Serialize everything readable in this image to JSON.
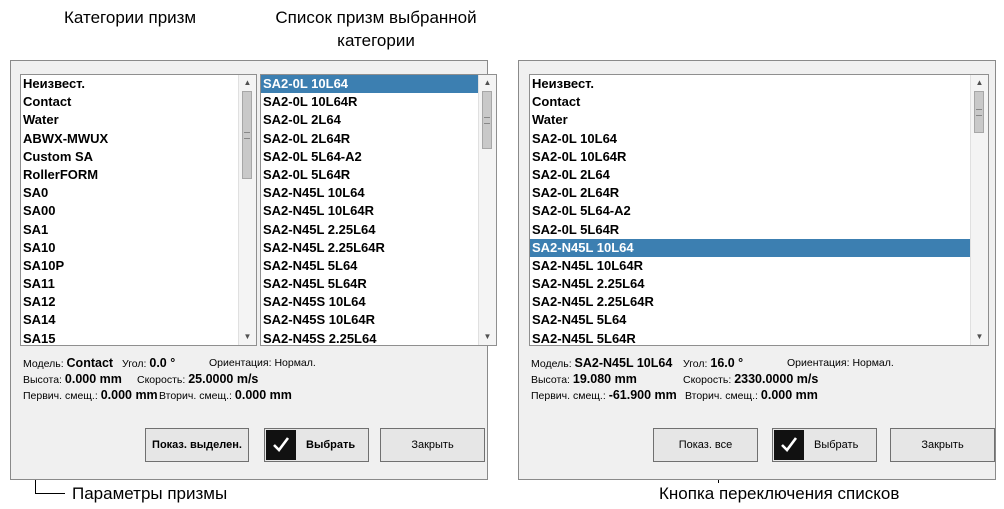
{
  "callouts": {
    "categories": "Категории призм",
    "list_line1": "Список призм выбранной",
    "list_line2": "категории",
    "params": "Параметры призмы",
    "switch_button": "Кнопка переключения списков"
  },
  "left_dialog": {
    "categories": [
      "Неизвест.",
      "Contact",
      "Water",
      "ABWX-MWUX",
      "Custom SA",
      "RollerFORM",
      "SA0",
      "SA00",
      "SA1",
      "SA10",
      "SA10P",
      "SA11",
      "SA12",
      "SA14",
      "SA15"
    ],
    "wedges": [
      "SA2-0L 10L64",
      "SA2-0L 10L64R",
      "SA2-0L 2L64",
      "SA2-0L 2L64R",
      "SA2-0L 5L64-A2",
      "SA2-0L 5L64R",
      "SA2-N45L 10L64",
      "SA2-N45L 10L64R",
      "SA2-N45L 2.25L64",
      "SA2-N45L 2.25L64R",
      "SA2-N45L 5L64",
      "SA2-N45L 5L64R",
      "SA2-N45S 10L64",
      "SA2-N45S 10L64R",
      "SA2-N45S 2.25L64"
    ],
    "selected_wedge": "SA2-0L 10L64",
    "params": {
      "model_label": "Модель:",
      "model_value": "Contact",
      "angle_label": "Угол:",
      "angle_value": "0.0 °",
      "orientation_label": "Ориентация:",
      "orientation_value": "Нормал.",
      "height_label": "Высота:",
      "height_value": "0.000 mm",
      "speed_label": "Скорость:",
      "speed_value": "25.0000 m/s",
      "primary_label": "Первич. смещ.:",
      "primary_value": "0.000 mm",
      "secondary_label": "Вторич. смещ.:",
      "secondary_value": "0.000 mm"
    },
    "buttons": {
      "toggle": "Показ. выделен.",
      "select": "Выбрать",
      "close": "Закрыть"
    }
  },
  "right_dialog": {
    "items": [
      "Неизвест.",
      "Contact",
      "Water",
      "SA2-0L 10L64",
      "SA2-0L 10L64R",
      "SA2-0L 2L64",
      "SA2-0L 2L64R",
      "SA2-0L 5L64-A2",
      "SA2-0L 5L64R",
      "SA2-N45L 10L64",
      "SA2-N45L 10L64R",
      "SA2-N45L 2.25L64",
      "SA2-N45L 2.25L64R",
      "SA2-N45L 5L64",
      "SA2-N45L 5L64R"
    ],
    "selected_item": "SA2-N45L 10L64",
    "params": {
      "model_label": "Модель:",
      "model_value": "SA2-N45L 10L64",
      "angle_label": "Угол:",
      "angle_value": "16.0 °",
      "orientation_label": "Ориентация:",
      "orientation_value": "Нормал.",
      "height_label": "Высота:",
      "height_value": "19.080 mm",
      "speed_label": "Скорость:",
      "speed_value": "2330.0000 m/s",
      "primary_label": "Первич. смещ.:",
      "primary_value": "-61.900 mm",
      "secondary_label": "Вторич. смещ.:",
      "secondary_value": "0.000 mm"
    },
    "buttons": {
      "toggle": "Показ. все",
      "select": "Выбрать",
      "close": "Закрыть"
    }
  },
  "colors": {
    "selection": "#3c7fb1",
    "panel_bg": "#f0f0f0",
    "check_bg": "#111111"
  }
}
